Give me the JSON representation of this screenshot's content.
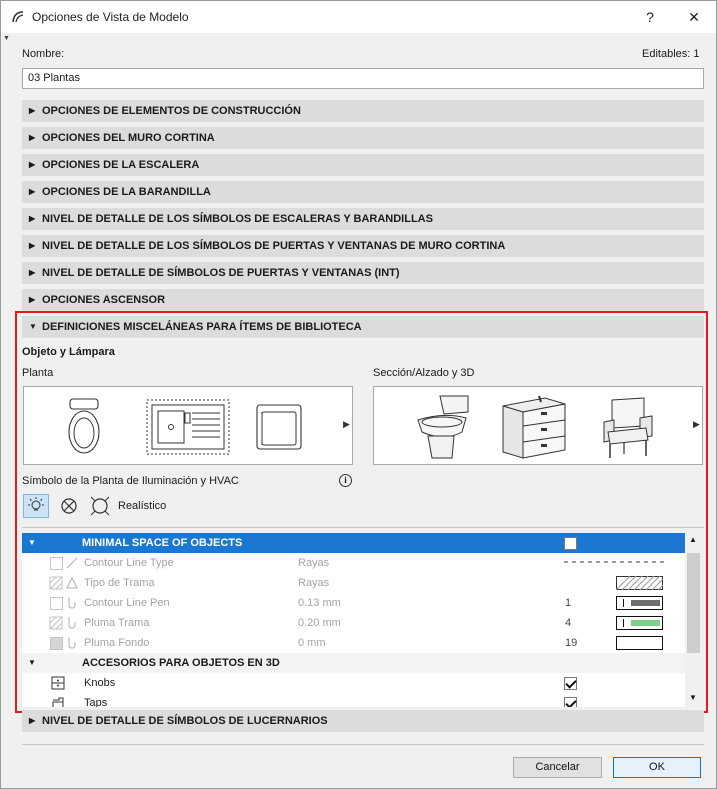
{
  "window": {
    "title": "Opciones de Vista de Modelo",
    "help_label": "?",
    "close_label": "✕"
  },
  "name_label": "Nombre:",
  "editables_label": "Editables: 1",
  "name_value": "03 Plantas",
  "sections_top": [
    "OPCIONES DE ELEMENTOS DE CONSTRUCCIÓN",
    "OPCIONES DEL MURO CORTINA",
    "OPCIONES DE LA ESCALERA",
    "OPCIONES DE LA BARANDILLA",
    "NIVEL DE DETALLE DE LOS SÍMBOLOS DE ESCALERAS Y BARANDILLAS",
    "NIVEL DE DETALLE DE LOS SÍMBOLOS DE PUERTAS Y VENTANAS DE MURO CORTINA",
    "NIVEL DE DETALLE DE SÍMBOLOS DE PUERTAS Y VENTANAS (INT)",
    "OPCIONES ASCENSOR"
  ],
  "expanded_section": "DEFINICIONES MISCELÁNEAS PARA ÍTEMS DE BIBLIOTECA",
  "object_lamp_label": "Objeto y Lámpara",
  "plan_label": "Planta",
  "section_3d_label": "Sección/Alzado y 3D",
  "lighting_label": "Símbolo de la Planta de Iluminación y HVAC",
  "realistic_label": "Realístico",
  "info_icon": "i",
  "table": {
    "header": "MINIMAL SPACE OF OBJECTS",
    "rows": [
      {
        "name": "Contour Line Type",
        "value": "Rayas",
        "num": ""
      },
      {
        "name": "Tipo de Trama",
        "value": "Rayas",
        "num": ""
      },
      {
        "name": "Contour Line Pen",
        "value": "0.13 mm",
        "num": "1"
      },
      {
        "name": "Pluma Trama",
        "value": "0.20 mm",
        "num": "4"
      },
      {
        "name": "Pluma Fondo",
        "value": "0 mm",
        "num": "19"
      }
    ],
    "sub_header": "ACCESORIOS PARA OBJETOS EN 3D",
    "sub_rows": [
      {
        "name": "Knobs",
        "checked": true
      },
      {
        "name": "Taps",
        "checked": true
      }
    ]
  },
  "section_bottom": "NIVEL DE DETALLE DE SÍMBOLOS DE LUCERNARIOS",
  "buttons": {
    "cancel": "Cancelar",
    "ok": "OK"
  },
  "colors": {
    "header_blue": "#1b78d0",
    "highlight_red": "#e31b1b",
    "pen_gray": "#6e6e6e",
    "pen_green": "#7fcf8a"
  }
}
